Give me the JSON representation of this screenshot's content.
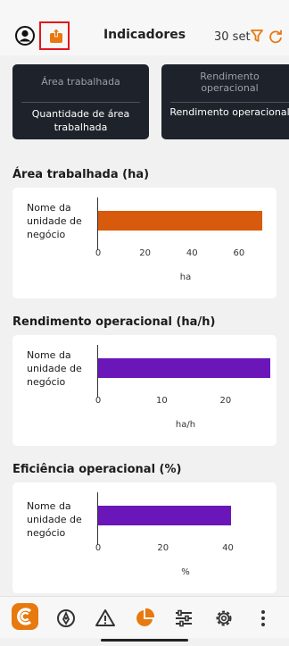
{
  "header": {
    "title": "Indicadores",
    "date": "30 set",
    "icons": [
      "avatar-icon",
      "share-icon",
      "filter-icon",
      "refresh-icon"
    ]
  },
  "tiles": [
    {
      "top": "Área trabalhada",
      "bottom": "Quantidade de área trabalhada"
    },
    {
      "top": "Rendimento operacional",
      "bottom": "Rendimento operacional"
    }
  ],
  "sections": [
    {
      "title": "Área trabalhada (ha)",
      "unit": "ha"
    },
    {
      "title": "Rendimento operacional (ha/h)",
      "unit": "ha/h"
    },
    {
      "title": "Eficiência operacional (%)",
      "unit": "%"
    }
  ],
  "category_label": "Nome da unidade de negócio",
  "colors": {
    "accent": "#e8790f",
    "bar_orange": "#d85a0c",
    "bar_purple": "#6a16b8",
    "tile_bg": "#1e232b"
  },
  "chart_data": [
    {
      "type": "bar",
      "orientation": "horizontal",
      "categories": [
        "Nome da unidade de negócio"
      ],
      "values": [
        70
      ],
      "xticks": [
        0,
        20,
        40,
        60
      ],
      "xlabel": "ha",
      "xlim": [
        0,
        76
      ]
    },
    {
      "type": "bar",
      "orientation": "horizontal",
      "categories": [
        "Nome da unidade de negócio"
      ],
      "values": [
        27
      ],
      "xticks": [
        0,
        10,
        20
      ],
      "xlabel": "ha/h",
      "xlim": [
        0,
        28
      ]
    },
    {
      "type": "bar",
      "orientation": "horizontal",
      "categories": [
        "Nome da unidade de negócio"
      ],
      "values": [
        41
      ],
      "xticks": [
        0,
        20,
        40
      ],
      "xlabel": "%",
      "xlim": [
        0,
        55
      ]
    }
  ],
  "nav": {
    "items": [
      "logo-icon",
      "rocket-icon",
      "alert-icon",
      "pie-chart-icon",
      "sliders-icon",
      "gear-icon",
      "more-icon"
    ],
    "active": "pie-chart-icon"
  }
}
